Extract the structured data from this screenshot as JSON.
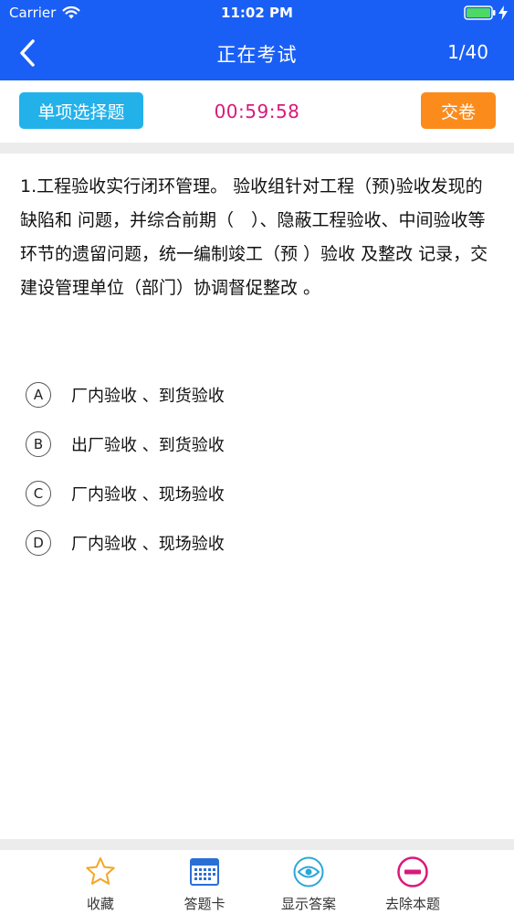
{
  "status_bar": {
    "carrier": "Carrier",
    "time": "11:02 PM"
  },
  "nav": {
    "title": "正在考试",
    "progress": "1/40"
  },
  "toolbar": {
    "question_type": "单项选择题",
    "timer": "00:59:58",
    "submit_label": "交卷"
  },
  "question": {
    "text": "1.工程验收实行闭环管理。 验收组针对工程（预)验收发现的缺陷和 问题，并综合前期（　）、隐蔽工程验收、中间验收等环节的遗留问题，统一编制竣工（预 ）验收 及整改 记录，交建设管理单位（部门）协调督促整改 。",
    "options": [
      {
        "letter": "A",
        "text": "厂内验收 、到货验收"
      },
      {
        "letter": "B",
        "text": "出厂验收 、到货验收"
      },
      {
        "letter": "C",
        "text": "厂内验收 、现场验收"
      },
      {
        "letter": "D",
        "text": "厂内验收 、现场验收"
      }
    ]
  },
  "tabs": [
    {
      "label": "收藏",
      "icon": "star-icon"
    },
    {
      "label": "答题卡",
      "icon": "answer-card-icon"
    },
    {
      "label": "显示答案",
      "icon": "eye-icon"
    },
    {
      "label": "去除本题",
      "icon": "remove-icon"
    }
  ],
  "colors": {
    "header": "#1a5ff5",
    "badge": "#23b1ea",
    "timer": "#d9197a",
    "submit": "#fb8c1c",
    "star": "#f5a623",
    "card": "#2a6fd6",
    "eye": "#2aa7d8",
    "remove": "#d9197a"
  }
}
